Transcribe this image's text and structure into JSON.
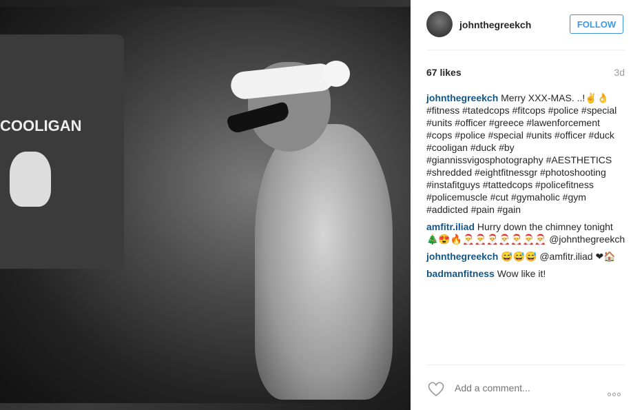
{
  "post": {
    "username": "johnthegreekch",
    "follow_label": "FOLLOW",
    "likes": "67 likes",
    "time": "3d"
  },
  "comments": [
    {
      "user": "johnthegreekch",
      "text": "Merry XXX-MAS. ..!✌👌 #fitness #tatedcops #fitcops #police #special #units #officer #greece #lawenforcement #cops #police #special #units #officer #duck #cooligan #duck #by #giannissvigosphotography #AESTHETICS #shredded #eightfitnessgr #photoshooting #instafitguys #tattedcops #policefitness #policemuscle #cut #gymaholic #gym #addicted #pain #gain"
    },
    {
      "user": "amfitr.iliad",
      "text": "Hurry down the chimney tonight 🎄😍🔥🎅🎅🎅🎅🎅🎅🎅 @johnthegreekch"
    },
    {
      "user": "johnthegreekch",
      "text": "😅😅😅 @amfitr.iliad ❤🏠"
    },
    {
      "user": "badmanfitness",
      "text": "Wow like it!"
    }
  ],
  "add_comment": {
    "placeholder": "Add a comment..."
  },
  "photo": {
    "shirt_text": "COOLIGAN"
  },
  "icons": {
    "heart": "heart-outline-icon",
    "more": "more-options-icon"
  },
  "colors": {
    "follow": "#3897f0",
    "user_link": "#125688",
    "muted": "#999999"
  }
}
